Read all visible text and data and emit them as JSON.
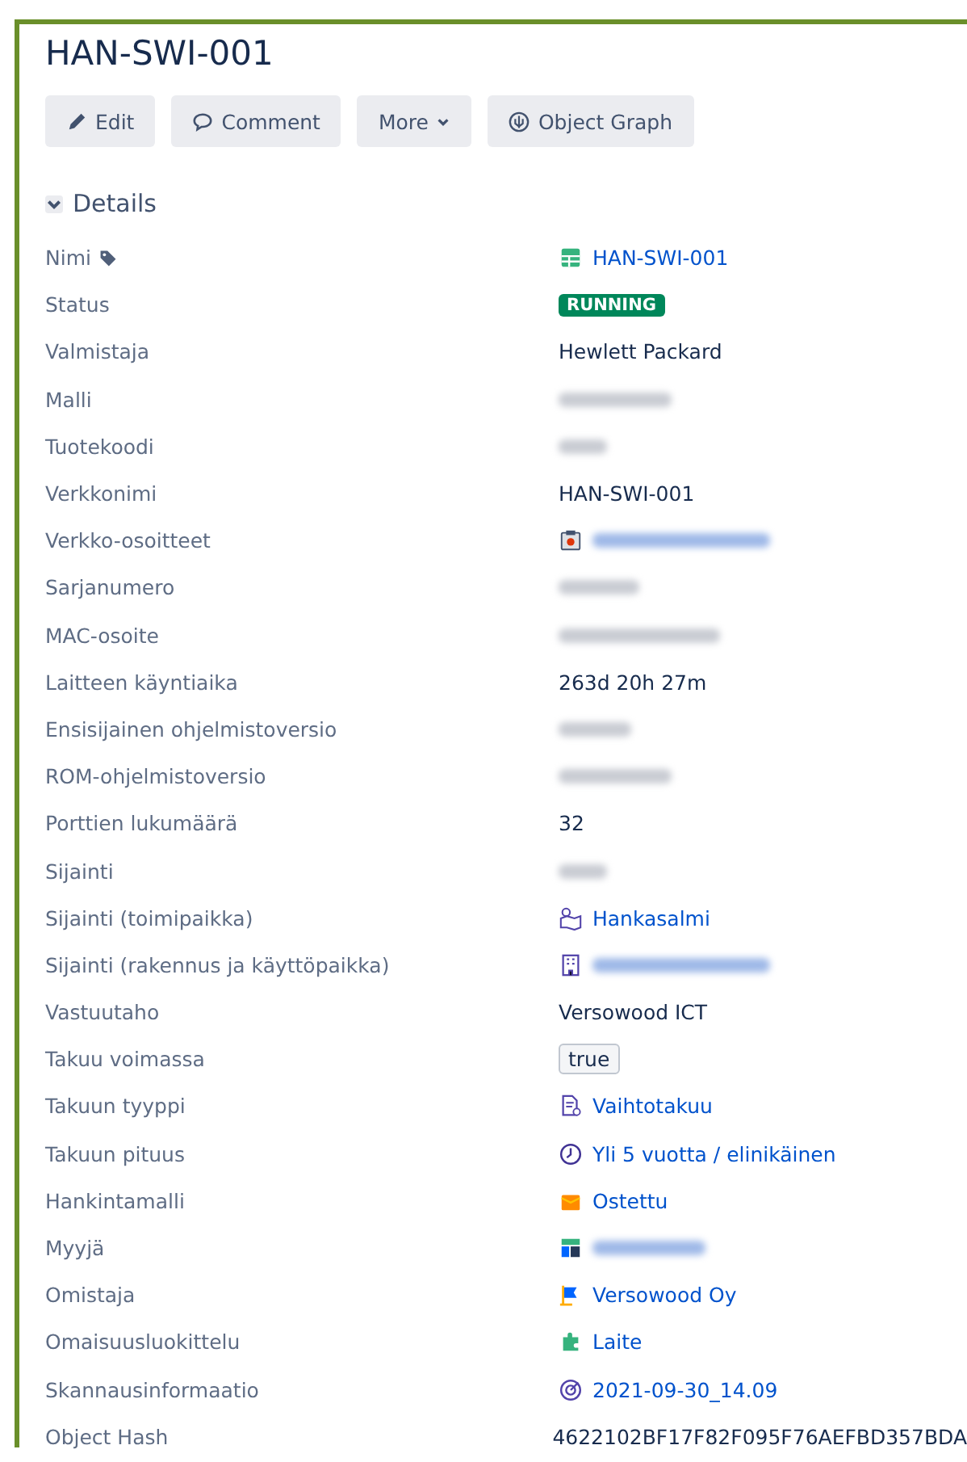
{
  "title": "HAN-SWI-001",
  "buttons": [
    {
      "label": "Edit",
      "kind": "edit"
    },
    {
      "label": "Comment",
      "kind": "comment"
    },
    {
      "label": "More",
      "kind": "more"
    },
    {
      "label": "Object Graph",
      "kind": "graph"
    }
  ],
  "section": {
    "title": "Details",
    "expanded": true
  },
  "rows": [
    {
      "label": "Nimi",
      "tag": true,
      "kind": "link",
      "value": "HAN-SWI-001",
      "icon": true
    },
    {
      "label": "Status",
      "kind": "badge",
      "value": "RUNNING"
    },
    {
      "label": "Valmistaja",
      "kind": "text",
      "value": "Hewlett Packard"
    },
    {
      "label": "Malli",
      "kind": "redacted"
    },
    {
      "label": "Tuotekoodi",
      "kind": "redacted"
    },
    {
      "label": "Verkkonimi",
      "kind": "text",
      "value": "HAN-SWI-001"
    },
    {
      "label": "Verkko-osoitteet",
      "kind": "redacted_link",
      "icon": true
    },
    {
      "label": "Sarjanumero",
      "kind": "redacted"
    },
    {
      "label": "MAC-osoite",
      "kind": "redacted"
    },
    {
      "label": "Laitteen käyntiaika",
      "kind": "text",
      "value": "263d 20h 27m"
    },
    {
      "label": "Ensisijainen ohjelmistoversio",
      "kind": "redacted"
    },
    {
      "label": "ROM-ohjelmistoversio",
      "kind": "redacted"
    },
    {
      "label": "Porttien lukumäärä",
      "kind": "text",
      "value": "32"
    },
    {
      "label": "Sijainti",
      "kind": "redacted"
    },
    {
      "label": "Sijainti (toimipaikka)",
      "kind": "link",
      "value": "Hankasalmi",
      "icon": true
    },
    {
      "label": "Sijainti (rakennus ja käyttöpaikka)",
      "kind": "redacted_link",
      "icon": true
    },
    {
      "label": "Vastuutaho",
      "kind": "text",
      "value": "Versowood ICT"
    },
    {
      "label": "Takuu voimassa",
      "kind": "tag",
      "value": "true"
    },
    {
      "label": "Takuun tyyppi",
      "kind": "link",
      "value": "Vaihtotakuu",
      "icon": true
    },
    {
      "label": "Takuun pituus",
      "kind": "link",
      "value": "Yli 5 vuotta / elinikäinen",
      "icon": true
    },
    {
      "label": "Hankintamalli",
      "kind": "link",
      "value": "Ostettu",
      "icon": true
    },
    {
      "label": "Myyjä",
      "kind": "redacted_link",
      "icon": true
    },
    {
      "label": "Omistaja",
      "kind": "link",
      "value": "Versowood Oy",
      "icon": true
    },
    {
      "label": "Omaisuusluokittelu",
      "kind": "link",
      "value": "Laite",
      "icon": true
    },
    {
      "label": "Skannausinformaatio",
      "kind": "link",
      "value": "2021-09-30_14.09",
      "icon": true
    },
    {
      "label": "Object Hash",
      "kind": "text",
      "value": "4622102BF17F82F095F76AEFBD357BDA"
    }
  ]
}
